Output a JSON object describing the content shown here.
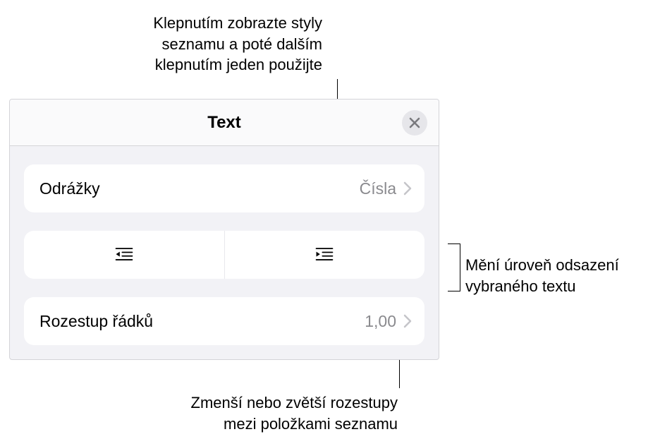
{
  "callouts": {
    "top": "Klepnutím zobrazte styly seznamu a poté dalším klepnutím jeden použijte",
    "right": "Mění úroveň odsazení\nvybraného textu",
    "bottom": "Zmenší nebo zvětší rozestupy\nmezi položkami seznamu"
  },
  "panel": {
    "title": "Text",
    "bullets": {
      "label": "Odrážky",
      "value": "Čísla"
    },
    "lineSpacing": {
      "label": "Rozestup řádků",
      "value": "1,00"
    }
  }
}
